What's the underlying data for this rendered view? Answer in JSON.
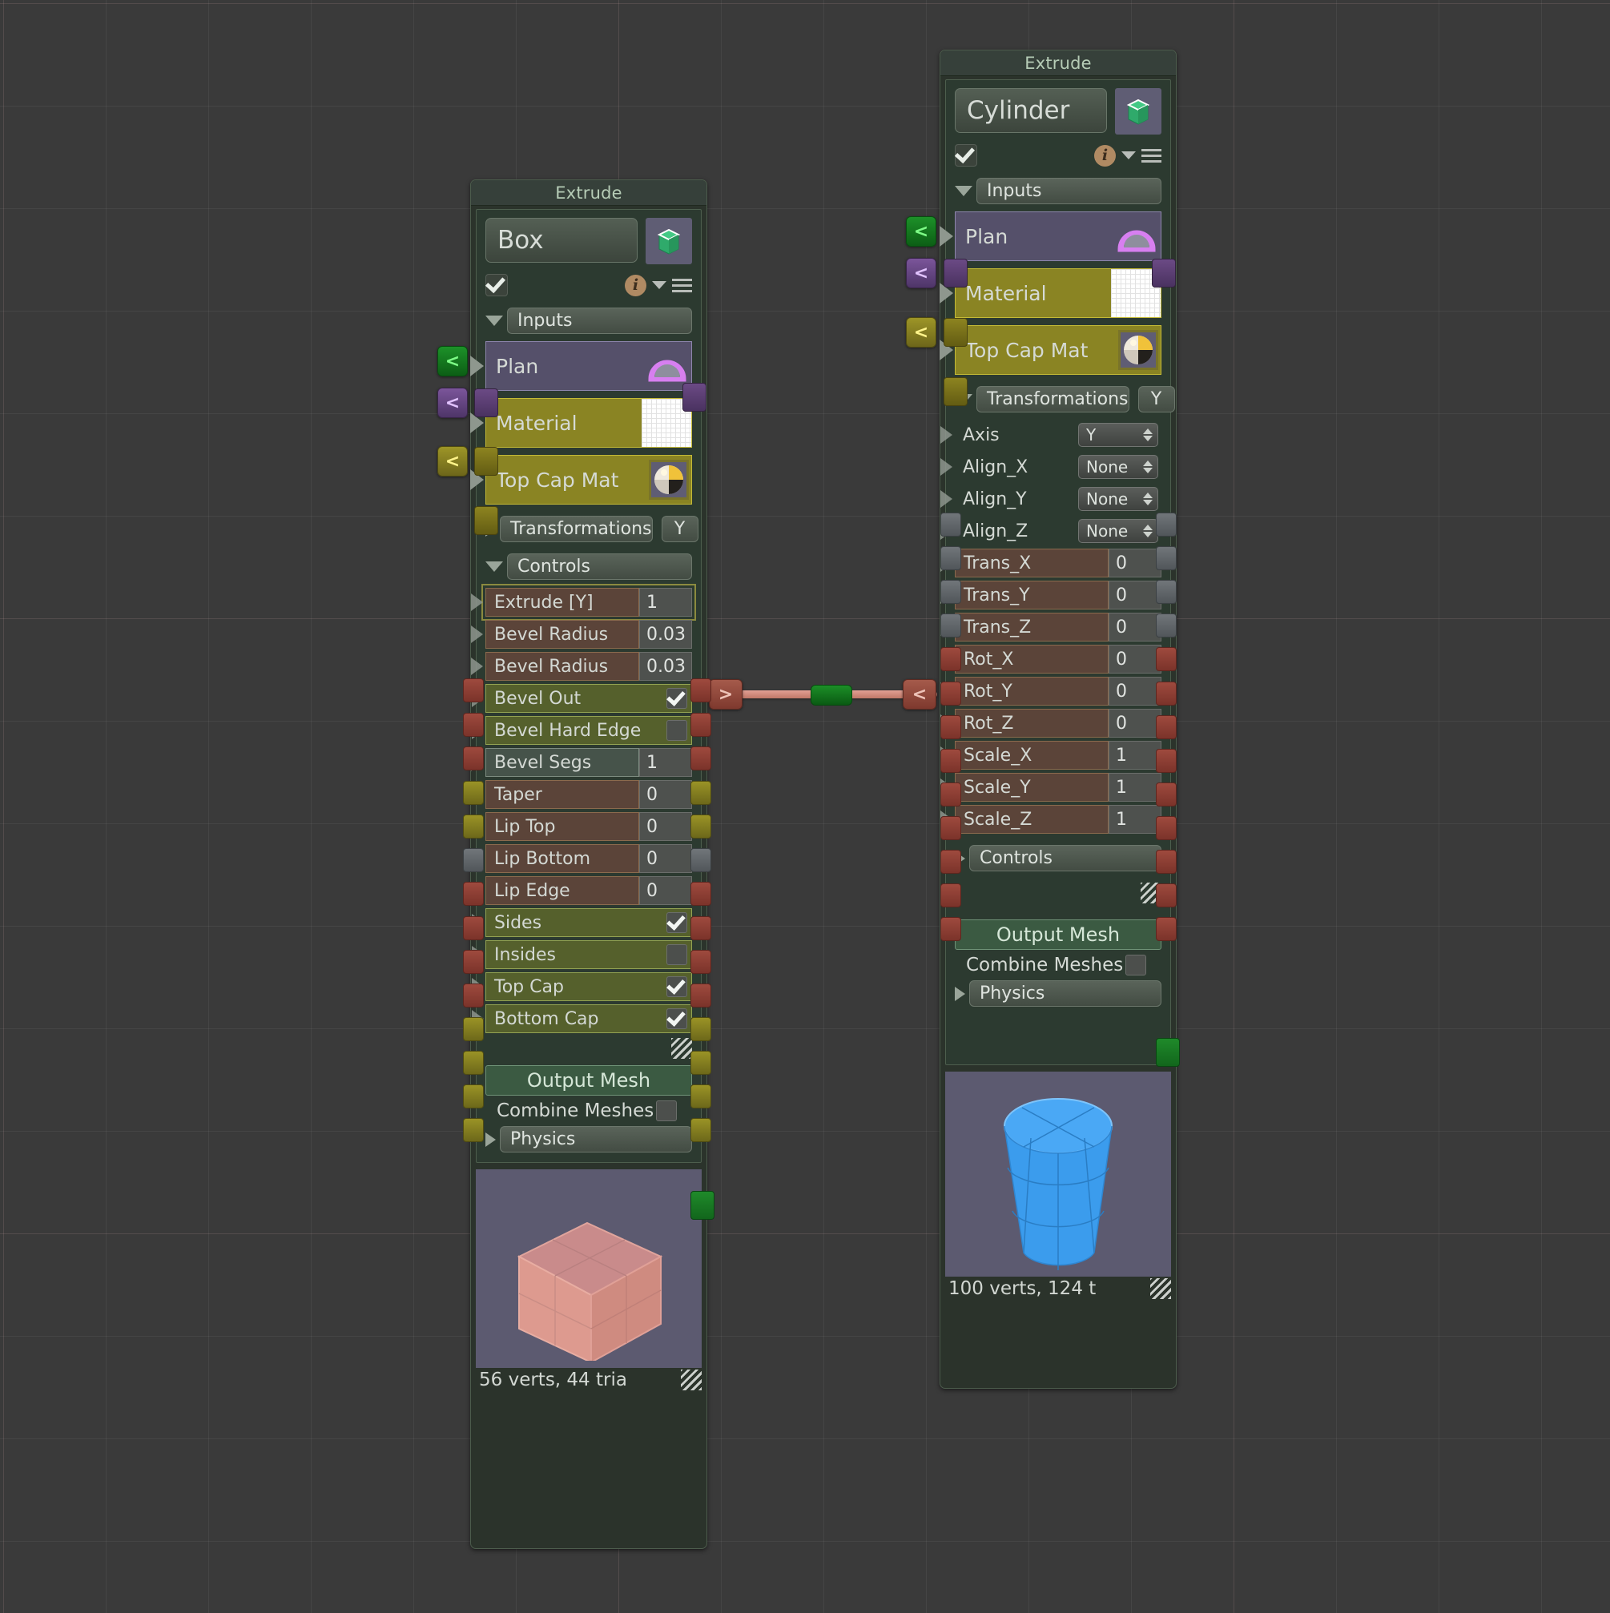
{
  "canvas": {
    "background": "#3a3a3a",
    "grid": true
  },
  "connection": {
    "from_label": ">",
    "to_label": "<",
    "color": "#d08878",
    "midpoint_label": ""
  },
  "nodes": [
    {
      "id": "box-node",
      "title": "Extrude",
      "name": "Box",
      "enabled": true,
      "enabled_checkbox": true,
      "icon": "extrude-shape-icon",
      "info_icon": "info-icon",
      "menu_icon": "hamburger-menu-icon",
      "sections": {
        "inputs": {
          "label": "Inputs",
          "expanded": true,
          "items": [
            {
              "label": "Plan",
              "type": "plan",
              "swatch": "plan-dome-icon"
            },
            {
              "label": "Material",
              "type": "material",
              "swatch": "white-grid-swatch"
            },
            {
              "label": "Top Cap Mat",
              "type": "material",
              "swatch": "sphere-material-icon"
            }
          ]
        },
        "transformations": {
          "label": "Transformations",
          "tag": "Y",
          "expanded": false,
          "items": []
        },
        "controls": {
          "label": "Controls",
          "expanded": true,
          "items": [
            {
              "label": "Extrude [Y]",
              "value": "1",
              "kind": "number",
              "style": "brown",
              "highlight": true
            },
            {
              "label": "Bevel Radius",
              "value": "0.03",
              "kind": "number",
              "style": "brown"
            },
            {
              "label": "Bevel Radius",
              "value": "0.03",
              "kind": "number",
              "style": "brown"
            },
            {
              "label": "Bevel Out",
              "value": true,
              "kind": "checkbox",
              "style": "olive"
            },
            {
              "label": "Bevel Hard Edge",
              "value": false,
              "kind": "checkbox",
              "style": "olive"
            },
            {
              "label": "Bevel Segs",
              "value": "1",
              "kind": "number",
              "style": "grey"
            },
            {
              "label": "Taper",
              "value": "0",
              "kind": "number",
              "style": "brown"
            },
            {
              "label": "Lip Top",
              "value": "0",
              "kind": "number",
              "style": "brown"
            },
            {
              "label": "Lip Bottom",
              "value": "0",
              "kind": "number",
              "style": "brown"
            },
            {
              "label": "Lip Edge",
              "value": "0",
              "kind": "number",
              "style": "brown"
            },
            {
              "label": "Sides",
              "value": true,
              "kind": "checkbox",
              "style": "olive"
            },
            {
              "label": "Insides",
              "value": false,
              "kind": "checkbox",
              "style": "olive"
            },
            {
              "label": "Top Cap",
              "value": true,
              "kind": "checkbox",
              "style": "olive"
            },
            {
              "label": "Bottom Cap",
              "value": true,
              "kind": "checkbox",
              "style": "olive"
            }
          ]
        }
      },
      "output": {
        "label": "Output Mesh",
        "combine_label": "Combine Meshes",
        "combine_value": false
      },
      "physics": {
        "label": "Physics",
        "expanded": false
      },
      "preview": {
        "shape": "box",
        "color": "#d58f8a"
      },
      "stats": "56 verts, 44 tria"
    },
    {
      "id": "cylinder-node",
      "title": "Extrude",
      "name": "Cylinder",
      "enabled": true,
      "enabled_checkbox": true,
      "icon": "extrude-shape-icon",
      "info_icon": "info-icon",
      "menu_icon": "hamburger-menu-icon",
      "sections": {
        "inputs": {
          "label": "Inputs",
          "expanded": true,
          "items": [
            {
              "label": "Plan",
              "type": "plan",
              "swatch": "plan-dome-icon"
            },
            {
              "label": "Material",
              "type": "material",
              "swatch": "white-grid-swatch"
            },
            {
              "label": "Top Cap Mat",
              "type": "material",
              "swatch": "sphere-material-icon"
            }
          ]
        },
        "transformations": {
          "label": "Transformations",
          "tag": "Y",
          "expanded": true,
          "items": [
            {
              "label": "Axis",
              "value": "Y",
              "kind": "dropdown",
              "style": "plain"
            },
            {
              "label": "Align_X",
              "value": "None",
              "kind": "dropdown",
              "style": "plain"
            },
            {
              "label": "Align_Y",
              "value": "None",
              "kind": "dropdown",
              "style": "plain"
            },
            {
              "label": "Align_Z",
              "value": "None",
              "kind": "dropdown",
              "style": "plain"
            },
            {
              "label": "Trans_X",
              "value": "0",
              "kind": "number",
              "style": "brown"
            },
            {
              "label": "Trans_Y",
              "value": "0",
              "kind": "number",
              "style": "brown"
            },
            {
              "label": "Trans_Z",
              "value": "0",
              "kind": "number",
              "style": "brown"
            },
            {
              "label": "Rot_X",
              "value": "0",
              "kind": "number",
              "style": "brown"
            },
            {
              "label": "Rot_Y",
              "value": "0",
              "kind": "number",
              "style": "brown"
            },
            {
              "label": "Rot_Z",
              "value": "0",
              "kind": "number",
              "style": "brown"
            },
            {
              "label": "Scale_X",
              "value": "1",
              "kind": "number",
              "style": "brown"
            },
            {
              "label": "Scale_Y",
              "value": "1",
              "kind": "number",
              "style": "brown"
            },
            {
              "label": "Scale_Z",
              "value": "1",
              "kind": "number",
              "style": "brown"
            }
          ]
        },
        "controls": {
          "label": "Controls",
          "expanded": false,
          "items": []
        }
      },
      "output": {
        "label": "Output Mesh",
        "combine_label": "Combine Meshes",
        "combine_value": false
      },
      "physics": {
        "label": "Physics",
        "expanded": false
      },
      "preview": {
        "shape": "cylinder",
        "color": "#3b9ced"
      },
      "stats": "100 verts, 124 t"
    }
  ]
}
